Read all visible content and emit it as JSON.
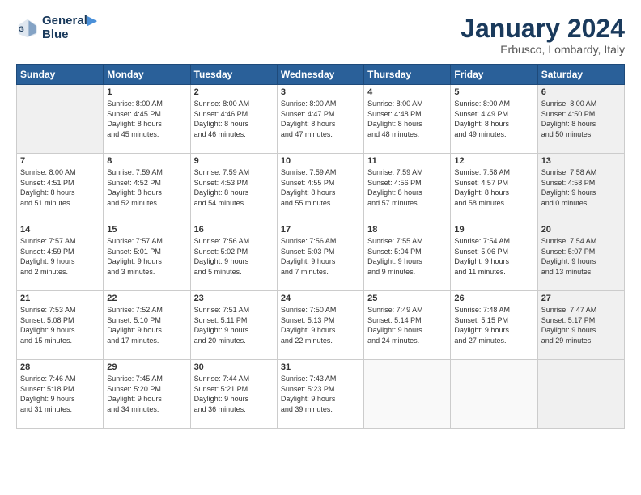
{
  "header": {
    "logo_line1": "General",
    "logo_line2": "Blue",
    "month": "January 2024",
    "location": "Erbusco, Lombardy, Italy"
  },
  "weekdays": [
    "Sunday",
    "Monday",
    "Tuesday",
    "Wednesday",
    "Thursday",
    "Friday",
    "Saturday"
  ],
  "weeks": [
    [
      {
        "day": "",
        "info": "",
        "shaded": true,
        "empty": true
      },
      {
        "day": "1",
        "info": "Sunrise: 8:00 AM\nSunset: 4:45 PM\nDaylight: 8 hours\nand 45 minutes."
      },
      {
        "day": "2",
        "info": "Sunrise: 8:00 AM\nSunset: 4:46 PM\nDaylight: 8 hours\nand 46 minutes."
      },
      {
        "day": "3",
        "info": "Sunrise: 8:00 AM\nSunset: 4:47 PM\nDaylight: 8 hours\nand 47 minutes."
      },
      {
        "day": "4",
        "info": "Sunrise: 8:00 AM\nSunset: 4:48 PM\nDaylight: 8 hours\nand 48 minutes."
      },
      {
        "day": "5",
        "info": "Sunrise: 8:00 AM\nSunset: 4:49 PM\nDaylight: 8 hours\nand 49 minutes."
      },
      {
        "day": "6",
        "info": "Sunrise: 8:00 AM\nSunset: 4:50 PM\nDaylight: 8 hours\nand 50 minutes.",
        "shaded": true
      }
    ],
    [
      {
        "day": "7",
        "info": "Sunrise: 8:00 AM\nSunset: 4:51 PM\nDaylight: 8 hours\nand 51 minutes."
      },
      {
        "day": "8",
        "info": "Sunrise: 7:59 AM\nSunset: 4:52 PM\nDaylight: 8 hours\nand 52 minutes."
      },
      {
        "day": "9",
        "info": "Sunrise: 7:59 AM\nSunset: 4:53 PM\nDaylight: 8 hours\nand 54 minutes."
      },
      {
        "day": "10",
        "info": "Sunrise: 7:59 AM\nSunset: 4:55 PM\nDaylight: 8 hours\nand 55 minutes."
      },
      {
        "day": "11",
        "info": "Sunrise: 7:59 AM\nSunset: 4:56 PM\nDaylight: 8 hours\nand 57 minutes."
      },
      {
        "day": "12",
        "info": "Sunrise: 7:58 AM\nSunset: 4:57 PM\nDaylight: 8 hours\nand 58 minutes."
      },
      {
        "day": "13",
        "info": "Sunrise: 7:58 AM\nSunset: 4:58 PM\nDaylight: 9 hours\nand 0 minutes.",
        "shaded": true
      }
    ],
    [
      {
        "day": "14",
        "info": "Sunrise: 7:57 AM\nSunset: 4:59 PM\nDaylight: 9 hours\nand 2 minutes."
      },
      {
        "day": "15",
        "info": "Sunrise: 7:57 AM\nSunset: 5:01 PM\nDaylight: 9 hours\nand 3 minutes."
      },
      {
        "day": "16",
        "info": "Sunrise: 7:56 AM\nSunset: 5:02 PM\nDaylight: 9 hours\nand 5 minutes."
      },
      {
        "day": "17",
        "info": "Sunrise: 7:56 AM\nSunset: 5:03 PM\nDaylight: 9 hours\nand 7 minutes."
      },
      {
        "day": "18",
        "info": "Sunrise: 7:55 AM\nSunset: 5:04 PM\nDaylight: 9 hours\nand 9 minutes."
      },
      {
        "day": "19",
        "info": "Sunrise: 7:54 AM\nSunset: 5:06 PM\nDaylight: 9 hours\nand 11 minutes."
      },
      {
        "day": "20",
        "info": "Sunrise: 7:54 AM\nSunset: 5:07 PM\nDaylight: 9 hours\nand 13 minutes.",
        "shaded": true
      }
    ],
    [
      {
        "day": "21",
        "info": "Sunrise: 7:53 AM\nSunset: 5:08 PM\nDaylight: 9 hours\nand 15 minutes."
      },
      {
        "day": "22",
        "info": "Sunrise: 7:52 AM\nSunset: 5:10 PM\nDaylight: 9 hours\nand 17 minutes."
      },
      {
        "day": "23",
        "info": "Sunrise: 7:51 AM\nSunset: 5:11 PM\nDaylight: 9 hours\nand 20 minutes."
      },
      {
        "day": "24",
        "info": "Sunrise: 7:50 AM\nSunset: 5:13 PM\nDaylight: 9 hours\nand 22 minutes."
      },
      {
        "day": "25",
        "info": "Sunrise: 7:49 AM\nSunset: 5:14 PM\nDaylight: 9 hours\nand 24 minutes."
      },
      {
        "day": "26",
        "info": "Sunrise: 7:48 AM\nSunset: 5:15 PM\nDaylight: 9 hours\nand 27 minutes."
      },
      {
        "day": "27",
        "info": "Sunrise: 7:47 AM\nSunset: 5:17 PM\nDaylight: 9 hours\nand 29 minutes.",
        "shaded": true
      }
    ],
    [
      {
        "day": "28",
        "info": "Sunrise: 7:46 AM\nSunset: 5:18 PM\nDaylight: 9 hours\nand 31 minutes."
      },
      {
        "day": "29",
        "info": "Sunrise: 7:45 AM\nSunset: 5:20 PM\nDaylight: 9 hours\nand 34 minutes."
      },
      {
        "day": "30",
        "info": "Sunrise: 7:44 AM\nSunset: 5:21 PM\nDaylight: 9 hours\nand 36 minutes."
      },
      {
        "day": "31",
        "info": "Sunrise: 7:43 AM\nSunset: 5:23 PM\nDaylight: 9 hours\nand 39 minutes."
      },
      {
        "day": "",
        "info": "",
        "empty": true
      },
      {
        "day": "",
        "info": "",
        "empty": true
      },
      {
        "day": "",
        "info": "",
        "empty": true,
        "shaded": true
      }
    ]
  ]
}
